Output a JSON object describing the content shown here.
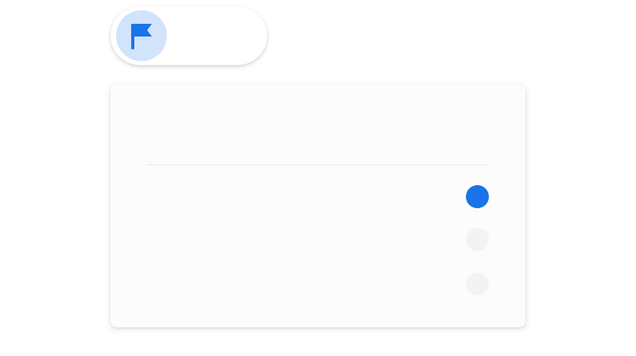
{
  "colors": {
    "accent": "#1a73e8",
    "icon_bg": "#d2e3fc",
    "radio_unselected": "#f1f3f4",
    "divider": "#e8eaed"
  },
  "pill": {
    "icon": "flag-icon",
    "label": ""
  },
  "card": {
    "title": "",
    "options": [
      {
        "label": "",
        "selected": true
      },
      {
        "label": "",
        "selected": false
      },
      {
        "label": "",
        "selected": false
      }
    ]
  }
}
